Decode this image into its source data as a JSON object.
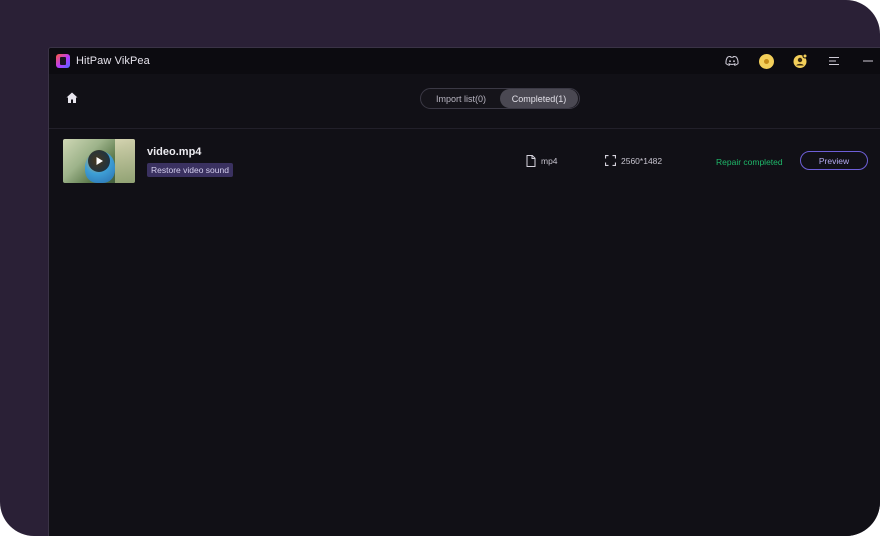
{
  "titlebar": {
    "app_title": "HitPaw VikPea",
    "icons": [
      "app-logo-icon",
      "discord-icon",
      "coin-icon",
      "account-icon",
      "menu-icon",
      "minimize-icon"
    ]
  },
  "header": {
    "tabs": [
      {
        "label": "Import list(0)",
        "active": false
      },
      {
        "label": "Completed(1)",
        "active": true
      }
    ]
  },
  "items": [
    {
      "file_name": "video.mp4",
      "tag": "Restore video sound",
      "format": "mp4",
      "resolution": "2560*1482",
      "status": "Repair completed",
      "preview_label": "Preview"
    }
  ],
  "colors": {
    "status_green": "#1fb86a",
    "accent_purple": "#6e5fd8",
    "tag_bg": "#3a3160"
  }
}
